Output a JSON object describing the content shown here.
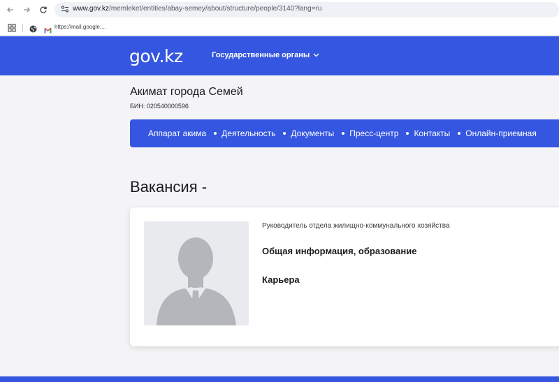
{
  "browser": {
    "url_host": "www.gov.kz",
    "url_path": "/memleket/entities/abay-semey/about/structure/people/3140?lang=ru",
    "bookmark": "https://mail.google...."
  },
  "header": {
    "logo": "gov.kz",
    "menu_label": "Государственные органы"
  },
  "org": {
    "name": "Акимат города Семей",
    "bin": "БИН: 020540000596",
    "nav": [
      "Аппарат акима",
      "Деятельность",
      "Документы",
      "Пресс-центр",
      "Контакты",
      "Онлайн-приемная"
    ]
  },
  "page": {
    "title": "Вакансия -"
  },
  "card": {
    "position": "Руководитель отдела жилищно-коммунального хозяйства",
    "section_general": "Общая информация, образование",
    "section_career": "Карьера"
  },
  "colors": {
    "brand_blue": "#3556e0",
    "page_bg": "#f4f4f6"
  }
}
